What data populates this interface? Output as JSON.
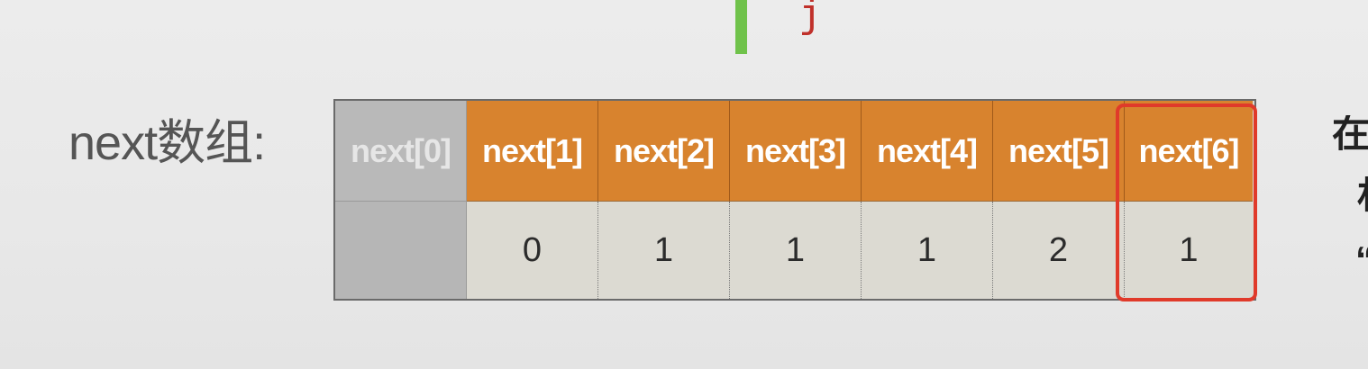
{
  "pointer": {
    "label": "j",
    "bar_color": "#6fc24a",
    "label_color": "#c0302a"
  },
  "array": {
    "label": "next数组:",
    "headers": [
      "next[0]",
      "next[1]",
      "next[2]",
      "next[3]",
      "next[4]",
      "next[5]",
      "next[6]"
    ],
    "values": [
      "",
      "0",
      "1",
      "1",
      "1",
      "2",
      "1"
    ],
    "header_color": "#d8832e",
    "disabled_color": "#b9b9b9",
    "highlighted_index": 6,
    "highlight_color": "#e03a2a"
  },
  "side_text": [
    "在",
    "材",
    "“"
  ]
}
